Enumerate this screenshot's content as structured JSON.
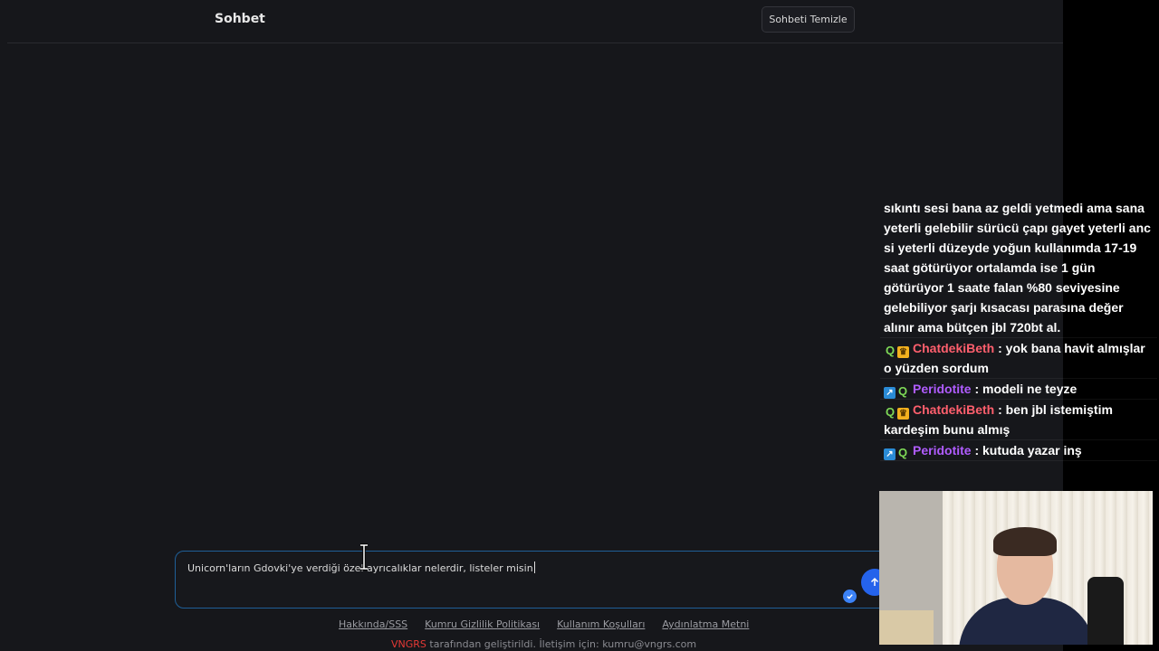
{
  "app": {
    "title": "Sohbet",
    "clear_button": "Sohbeti Temizle"
  },
  "composer": {
    "text": "Unicorn'ların Gdovki'ye verdiği özel ayrıcalıklar nelerdir, listeler misin"
  },
  "footer": {
    "links": [
      "Hakkında/SSS",
      "Kumru Gizlilik Politikası",
      "Kullanım Koşulları",
      "Aydınlatma Metni"
    ],
    "brand": "VNGRS",
    "credit": " tarafından geliştirildi. İletişim için: kumru@vngrs.com"
  },
  "stream_chat": {
    "messages": [
      {
        "user": "",
        "text": "sıkıntı sesi bana az geldi yetmedi ama sana yeterli gelebilir sürücü çapı gayet yeterli anc si yeterli düzeyde yoğun kullanımda 17-19 saat götürüyor ortalamda ise 1 gün götürüyor 1 saate falan %80 seviyesine gelebiliyor şarjı kısacası parasına değer alınır ama bütçen jbl 720bt al.",
        "user_color": ""
      },
      {
        "user": "ChatdekiBeth",
        "text": " : yok bana havit almışlar o yüzden sordum",
        "user_color": "#ff5f6d"
      },
      {
        "user": "Peridotite",
        "text": " : modeli ne teyze",
        "user_color": "#b05cff"
      },
      {
        "user": "ChatdekiBeth",
        "text": " : ben jbl istemiştim kardeşim bunu almış",
        "user_color": "#ff5f6d"
      },
      {
        "user": "Peridotite",
        "text": " : kutuda yazar inş",
        "user_color": "#b05cff"
      }
    ]
  },
  "colors": {
    "accent": "#2563eb",
    "brand": "#e53935",
    "background": "#16171b"
  }
}
